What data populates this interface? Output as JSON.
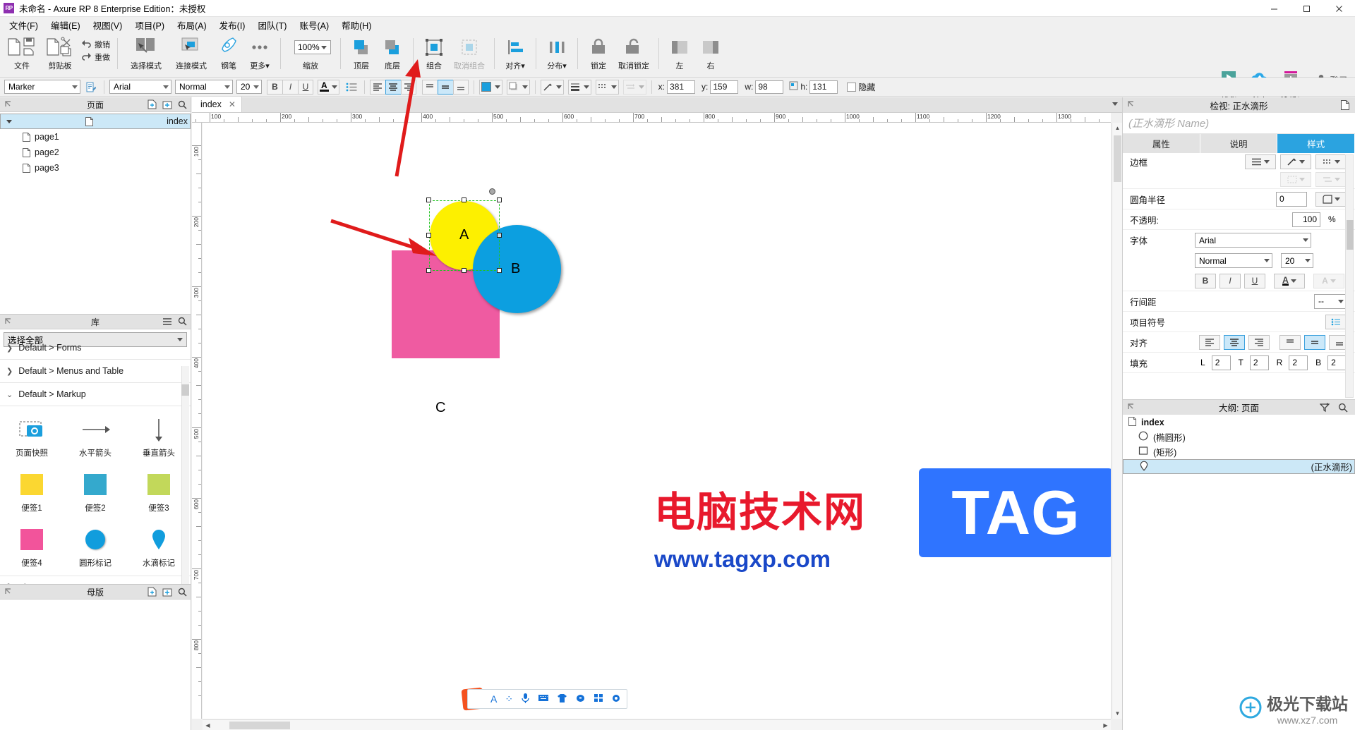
{
  "window": {
    "app_badge": "RP",
    "title": "未命名 - Axure RP 8 Enterprise Edition：未授权",
    "minimize": "—",
    "maximize": "▢",
    "close": "✕"
  },
  "menubar": {
    "items": [
      "文件(F)",
      "编辑(E)",
      "视图(V)",
      "项目(P)",
      "布局(A)",
      "发布(I)",
      "团队(T)",
      "账号(A)",
      "帮助(H)"
    ]
  },
  "ribbon": {
    "file_label": "文件",
    "clipboard_label": "剪贴板",
    "undo_label": "撤销",
    "redo_label": "重做",
    "select_mode_label": "选择模式",
    "connect_mode_label": "连接模式",
    "pen_label": "钢笔",
    "more_label": "更多▾",
    "zoom_value": "100%",
    "zoom_label": "缩放",
    "bring_front_label": "顶层",
    "send_back_label": "底层",
    "group_label": "组合",
    "ungroup_label": "取消组合",
    "align_label": "对齐▾",
    "distribute_label": "分布▾",
    "lock_label": "锁定",
    "unlock_label": "取消锁定",
    "left_label": "左",
    "right_label": "右"
  },
  "topright": {
    "preview_label": "预览",
    "share_label": "分享",
    "publish_label": "发布▾",
    "login_label": "登录"
  },
  "stylebar": {
    "style_value": "Marker",
    "font_value": "Arial",
    "weight_value": "Normal",
    "size_value": "20",
    "bold": "B",
    "italic": "I",
    "underline": "U",
    "font_color": "A",
    "bullets_icon": "list-icon",
    "align_left": "align-left-icon",
    "align_center": "align-center-icon",
    "align_right": "align-right-icon",
    "valign_top": "valign-top-icon",
    "valign_middle": "valign-middle-icon",
    "valign_bottom": "valign-bottom-icon",
    "fill_color": "#1b9fdd",
    "x_label": "x:",
    "x_value": "381",
    "y_label": "y:",
    "y_value": "159",
    "w_label": "w:",
    "w_value": "98",
    "h_label": "h:",
    "h_value": "131",
    "hide_label": "隐藏"
  },
  "pages_panel": {
    "title": "页面",
    "items": [
      {
        "label": "index",
        "level": 0,
        "selected": true
      },
      {
        "label": "page1",
        "level": 1,
        "selected": false
      },
      {
        "label": "page2",
        "level": 1,
        "selected": false
      },
      {
        "label": "page3",
        "level": 1,
        "selected": false
      }
    ]
  },
  "library_panel": {
    "title": "库",
    "select_value": "选择全部",
    "groups": [
      {
        "label": "Default > Forms",
        "open": false
      },
      {
        "label": "Default > Menus and Table",
        "open": false
      },
      {
        "label": "Default > Markup",
        "open": true
      },
      {
        "label": "Flow",
        "open": false
      }
    ],
    "widgets": [
      {
        "label": "页面快照",
        "kind": "snapshot"
      },
      {
        "label": "水平箭头",
        "kind": "h-arrow"
      },
      {
        "label": "垂直箭头",
        "kind": "v-arrow"
      },
      {
        "label": "便签1",
        "kind": "note",
        "color": "#fbd731"
      },
      {
        "label": "便签2",
        "kind": "note",
        "color": "#34a9cd"
      },
      {
        "label": "便签3",
        "kind": "note",
        "color": "#c2d85a"
      },
      {
        "label": "便签4",
        "kind": "note",
        "color": "#f2549b"
      },
      {
        "label": "圆形标记",
        "kind": "circle-marker",
        "color": "#119ddd"
      },
      {
        "label": "水滴标记",
        "kind": "drop-marker",
        "color": "#119ddd"
      }
    ]
  },
  "master_panel": {
    "title": "母版"
  },
  "canvas": {
    "tab_label": "index",
    "tab_close": "✕",
    "ruler_h_labels": [
      "100",
      "200",
      "300",
      "400",
      "500",
      "600",
      "700",
      "800",
      "900",
      "1000",
      "1100",
      "1200",
      "1300"
    ],
    "ruler_v_labels": [
      "100",
      "200",
      "300",
      "400",
      "500",
      "600",
      "700",
      "800"
    ],
    "shapes": [
      {
        "name": "ellipse-a",
        "label": "A",
        "fill": "#fdf000",
        "selected": true
      },
      {
        "name": "ellipse-b",
        "label": "B",
        "fill": "#0c9fe0",
        "selected": false
      },
      {
        "name": "rectangle-c",
        "label": "C",
        "fill": "#ef5ba1",
        "selected": false
      }
    ]
  },
  "inspector": {
    "title": "检视: 正水滴形",
    "name_placeholder": "(正水滴形 Name)",
    "tabs": [
      {
        "label": "属性",
        "active": false
      },
      {
        "label": "说明",
        "active": false
      },
      {
        "label": "样式",
        "active": true
      }
    ],
    "rows": {
      "border_label": "边框",
      "corner_label": "圆角半径",
      "corner_value": "0",
      "opacity_label": "不透明:",
      "opacity_value": "100",
      "opacity_unit": "%",
      "font_label": "字体",
      "font_value": "Arial",
      "weight_value": "Normal",
      "size_value": "20",
      "bold": "B",
      "italic": "I",
      "underline": "U",
      "fontcolor": "A",
      "shadowcolor": "A",
      "linespacing_label": "行间距",
      "linespacing_value": "--",
      "bullets_label": "项目符号",
      "align_label": "对齐",
      "padding_label": "填充",
      "pad_l_label": "L",
      "pad_l_value": "2",
      "pad_t_label": "T",
      "pad_t_value": "2",
      "pad_r_label": "R",
      "pad_r_value": "2",
      "pad_b_label": "B",
      "pad_b_value": "2"
    }
  },
  "outline": {
    "title": "大纲: 页面",
    "items": [
      {
        "label": "index",
        "icon": "page-icon",
        "level": 0,
        "selected": false
      },
      {
        "label": "(椭圆形)",
        "icon": "ellipse-icon",
        "level": 1,
        "selected": false
      },
      {
        "label": "(矩形)",
        "icon": "rect-icon",
        "level": 1,
        "selected": false
      },
      {
        "label": "(正水滴形)",
        "icon": "drop-icon",
        "level": 1,
        "selected": true
      }
    ]
  },
  "watermark": {
    "cn_text": "电脑技术网",
    "url_text": "www.tagxp.com",
    "tag_text": "TAG",
    "jg_title": "极光下载站",
    "jg_sub": "www.xz7.com"
  },
  "ime": {
    "logo": "S",
    "icons": [
      "A",
      "⁘",
      "🎤",
      "⌨",
      "👕",
      "◉",
      "▦",
      "✲"
    ]
  }
}
